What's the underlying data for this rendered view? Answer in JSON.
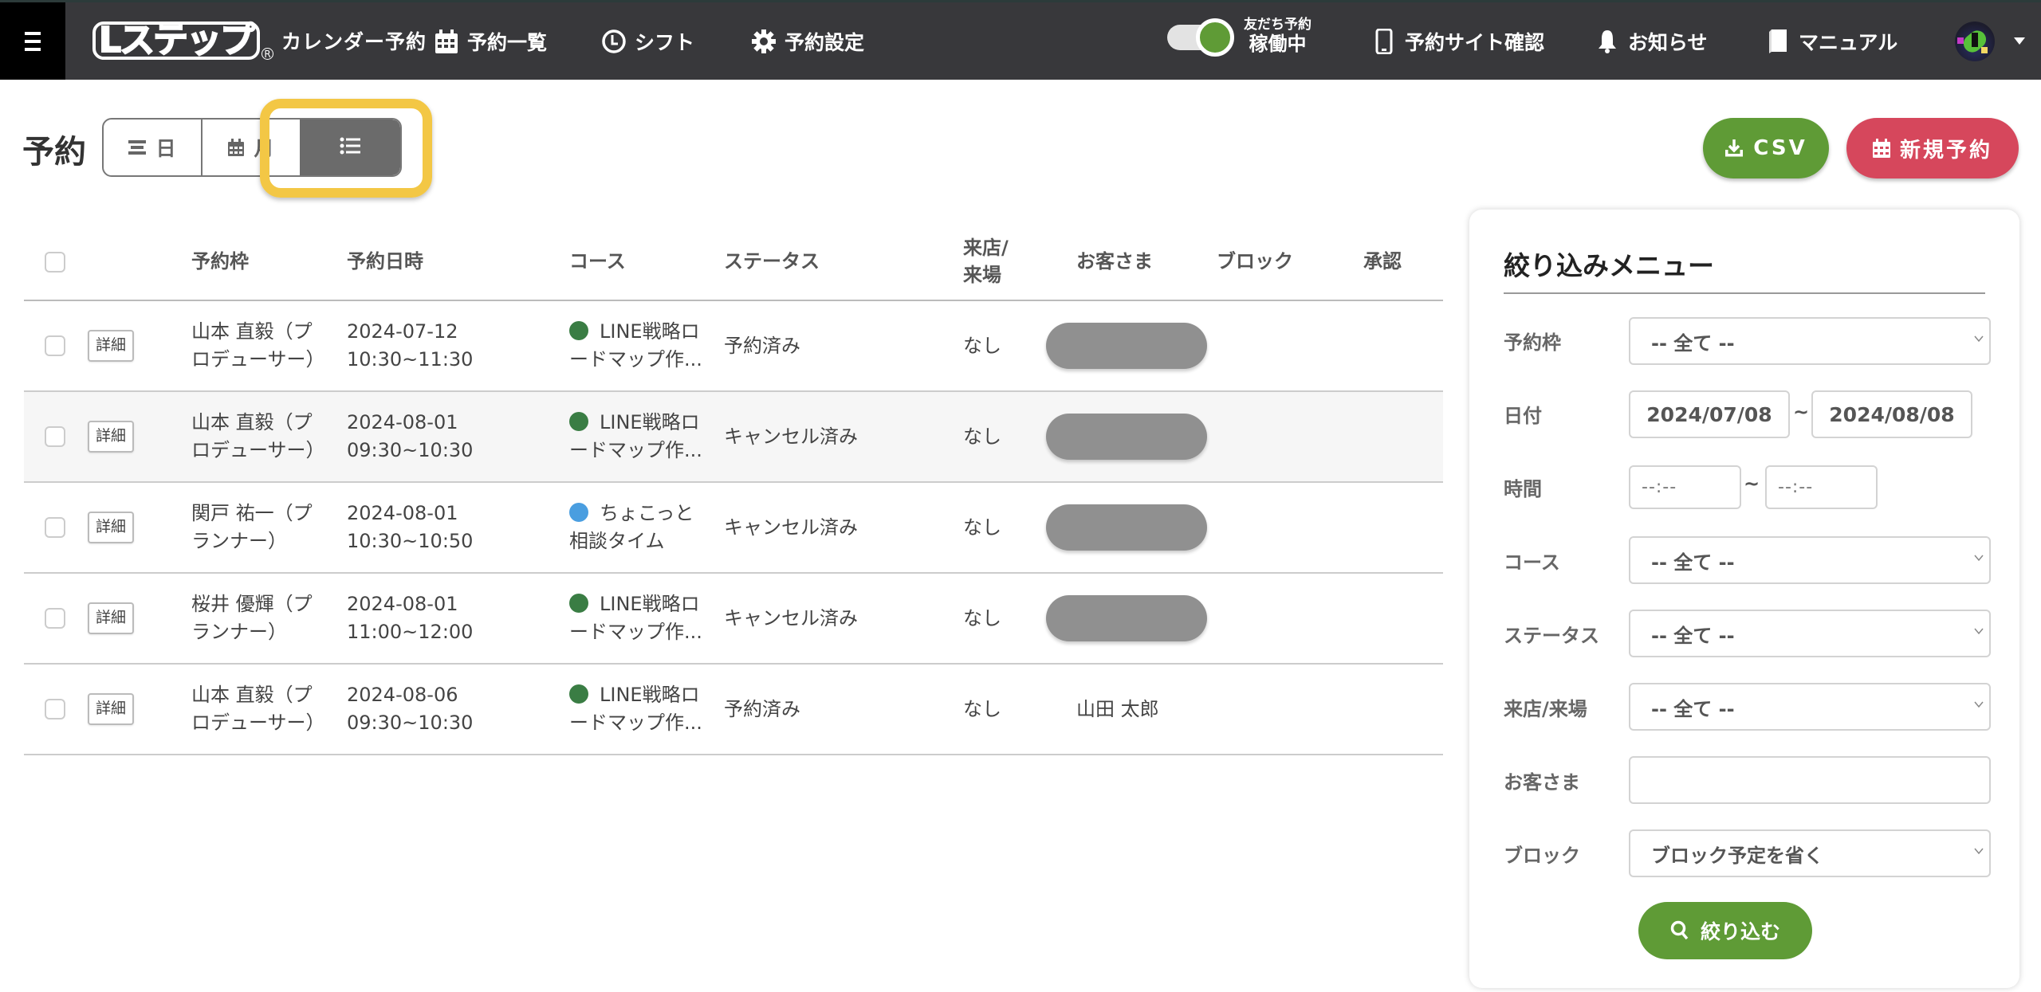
{
  "header": {
    "menu_icon": "hamburger-icon",
    "logo_text": "Lステップ",
    "logo_sub": "カレンダー予約",
    "nav": [
      {
        "label": "予約一覧",
        "icon": "calendar-icon"
      },
      {
        "label": "シフト",
        "icon": "clock-icon"
      },
      {
        "label": "予約設定",
        "icon": "gear-icon"
      }
    ],
    "toggle": {
      "label_top": "友だち予約",
      "label_status": "稼働中",
      "on": true
    },
    "nav_right": [
      {
        "label": "予約サイト確認",
        "icon": "smartphone-icon"
      },
      {
        "label": "お知らせ",
        "icon": "bell-icon"
      },
      {
        "label": "マニュアル",
        "icon": "book-icon"
      }
    ]
  },
  "page": {
    "title": "予約",
    "view_toggle": {
      "day_label": "日",
      "month_label": "月",
      "list_label": "",
      "active": "list"
    },
    "csv_label": "CSV",
    "new_label": "新規予約"
  },
  "table": {
    "columns": [
      "予約枠",
      "予約日時",
      "コース",
      "ステータス",
      "来店/来場",
      "お客さま",
      "ブロック",
      "承認"
    ],
    "detail_label": "詳細",
    "rows": [
      {
        "frame": "山本 直毅（プロデューサー）",
        "date": "2024-07-12",
        "time": "10:30~11:30",
        "course": "LINE戦略ロードマップ作...",
        "course_color": "#3a7d44",
        "status": "予約済み",
        "visit": "なし",
        "customer": "",
        "customer_hidden": true,
        "block": "",
        "approve": ""
      },
      {
        "frame": "山本 直毅（プロデューサー）",
        "date": "2024-08-01",
        "time": "09:30~10:30",
        "course": "LINE戦略ロードマップ作...",
        "course_color": "#3a7d44",
        "status": "キャンセル済み",
        "visit": "なし",
        "customer": "",
        "customer_hidden": true,
        "block": "",
        "approve": ""
      },
      {
        "frame": "関戸 祐一（プランナー）",
        "date": "2024-08-01",
        "time": "10:30~10:50",
        "course": "ちょこっと相談タイム",
        "course_color": "#4a9ee0",
        "status": "キャンセル済み",
        "visit": "なし",
        "customer": "",
        "customer_hidden": true,
        "block": "",
        "approve": ""
      },
      {
        "frame": "桜井 優輝（プランナー）",
        "date": "2024-08-01",
        "time": "11:00~12:00",
        "course": "LINE戦略ロードマップ作...",
        "course_color": "#3a7d44",
        "status": "キャンセル済み",
        "visit": "なし",
        "customer": "",
        "customer_hidden": true,
        "block": "",
        "approve": ""
      },
      {
        "frame": "山本 直毅（プロデューサー）",
        "date": "2024-08-06",
        "time": "09:30~10:30",
        "course": "LINE戦略ロードマップ作...",
        "course_color": "#3a7d44",
        "status": "予約済み",
        "visit": "なし",
        "customer": "山田 太郎",
        "customer_hidden": false,
        "block": "",
        "approve": ""
      }
    ]
  },
  "filter": {
    "title": "絞り込みメニュー",
    "frame_label": "予約枠",
    "frame_value": "-- 全て --",
    "date_label": "日付",
    "date_from": "2024/07/08",
    "date_to": "2024/08/08",
    "range_sep": "~",
    "time_label": "時間",
    "time_from": "--:--",
    "time_to": "--:--",
    "course_label": "コース",
    "course_value": "-- 全て --",
    "status_label": "ステータス",
    "status_value": "-- 全て --",
    "visit_label": "来店/来場",
    "visit_value": "-- 全て --",
    "customer_label": "お客さま",
    "customer_value": "",
    "block_label": "ブロック",
    "block_value": "ブロック予定を省く",
    "submit_label": "絞り込む"
  },
  "colors": {
    "header_bg": "#38383b",
    "green": "#5f9b36",
    "red": "#d6475c",
    "highlight": "#f3c745"
  }
}
